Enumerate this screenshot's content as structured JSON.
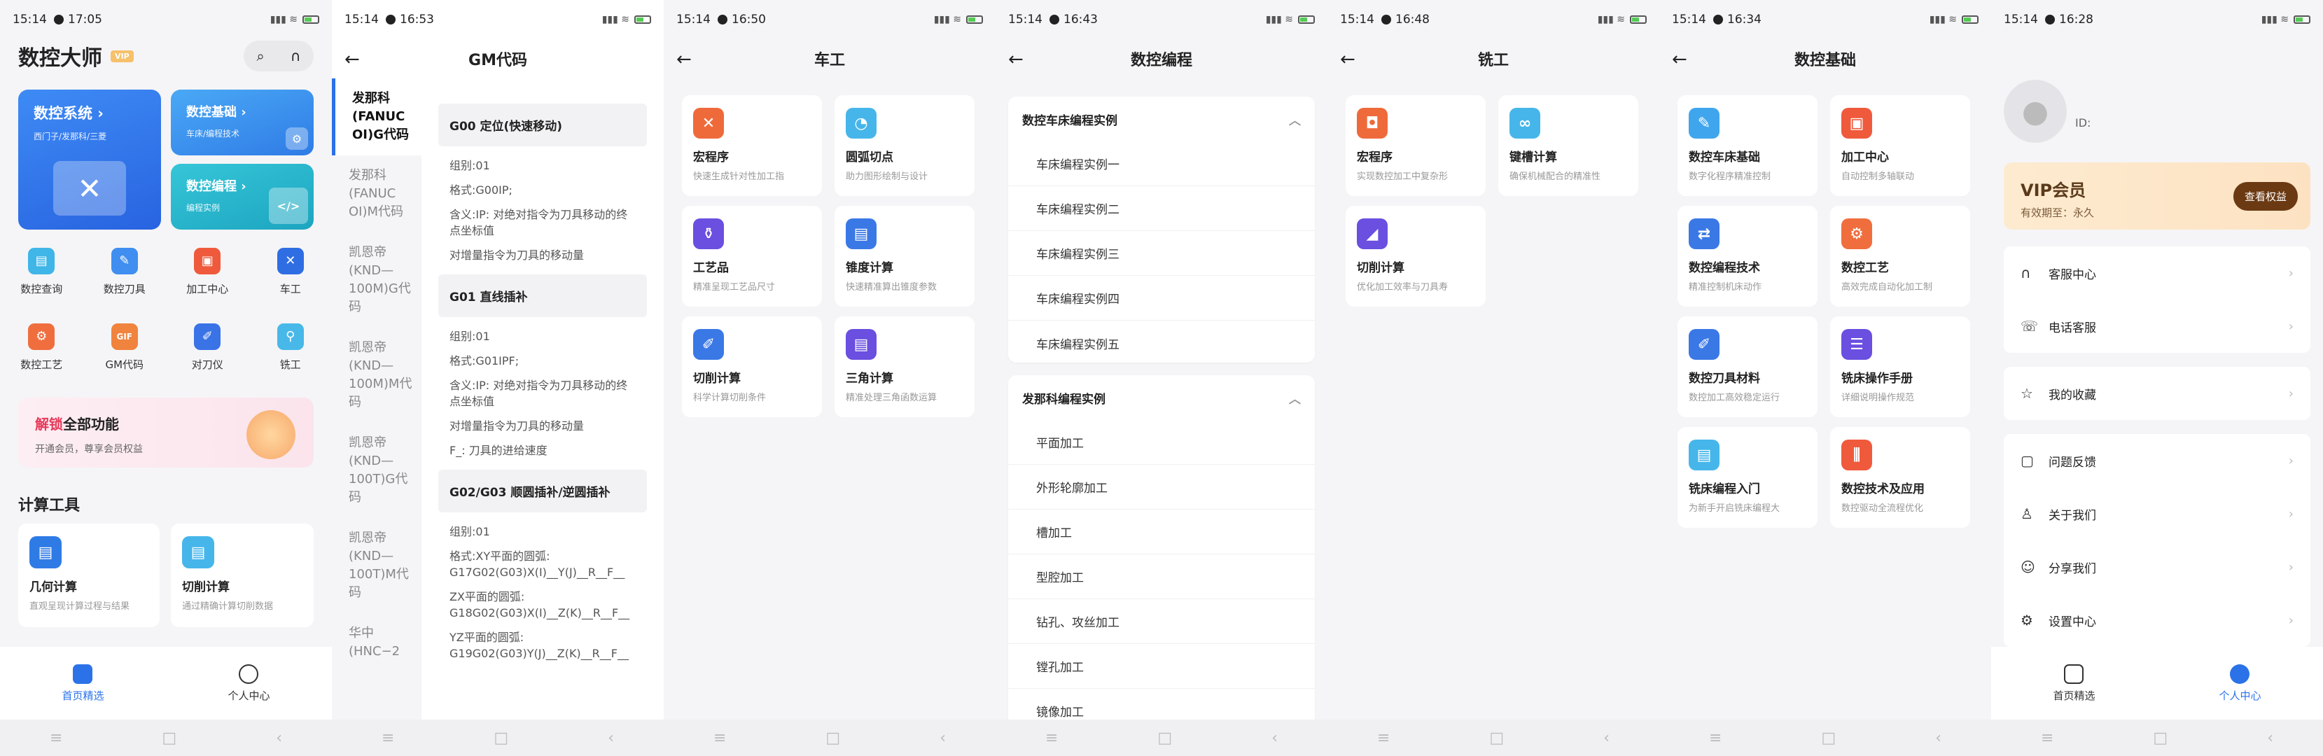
{
  "home": {
    "status": {
      "time": "15:14",
      "alarm": "17:05"
    },
    "app_title": "数控大师",
    "vip_badge": "VIP",
    "banners": [
      {
        "title": "数控系统 ›",
        "sub": "西门子/发那科/三菱"
      },
      {
        "title": "数控基础 ›",
        "sub": "车床/编程技术"
      },
      {
        "title": "数控编程 ›",
        "sub": "编程实例"
      }
    ],
    "grid": [
      {
        "label": "数控查询",
        "icon": "doc-icon",
        "color": "#3fb5e8"
      },
      {
        "label": "数控刀具",
        "icon": "tool-icon",
        "color": "#3f8ef0"
      },
      {
        "label": "加工中心",
        "icon": "machine-icon",
        "color": "#ef5a3c"
      },
      {
        "label": "车工",
        "icon": "lathe-icon",
        "color": "#2f6de3"
      },
      {
        "label": "数控工艺",
        "icon": "gear-icon",
        "color": "#f06e3e"
      },
      {
        "label": "GM代码",
        "icon": "gif-icon",
        "color": "#f0833e"
      },
      {
        "label": "对刀仪",
        "icon": "pen-icon",
        "color": "#3a73e6"
      },
      {
        "label": "铣工",
        "icon": "mill-icon",
        "color": "#48b8e9"
      }
    ],
    "unlock": {
      "title_red": "解锁",
      "title_rest": "全部功能",
      "sub": "开通会员，尊享会员权益"
    },
    "calc_heading": "计算工具",
    "calc": [
      {
        "title": "几何计算",
        "sub": "直观呈现计算过程与结果"
      },
      {
        "title": "切削计算",
        "sub": "通过精确计算切削数据"
      }
    ],
    "tabs": {
      "home": "首页精选",
      "me": "个人中心"
    }
  },
  "gm": {
    "status": {
      "time": "15:14",
      "alarm": "16:53"
    },
    "title": "GM代码",
    "side": [
      "发那科(FANUC OI)G代码",
      "发那科(FANUC OI)M代码",
      "凯恩帝(KND—100M)G代码",
      "凯恩帝(KND—100M)M代码",
      "凯恩帝(KND—100T)G代码",
      "凯恩帝(KND—100T)M代码",
      "华中(HNC−2"
    ],
    "blocks": [
      {
        "head": "G00 定位(快速移动)",
        "lines": [
          "组别:01",
          "格式:G00IP;",
          "含义:IP: 对绝对指令为刀具移动的终点坐标值",
          "对增量指令为刀具的移动量"
        ]
      },
      {
        "head": "G01 直线插补",
        "lines": [
          "组别:01",
          "格式:G01IPF;",
          "含义:IP: 对绝对指令为刀具移动的终点坐标值",
          "对增量指令为刀具的移动量",
          "F_: 刀具的进给速度"
        ]
      },
      {
        "head": "G02/G03 顺圆插补/逆圆插补",
        "lines": [
          "组别:01",
          "格式:XY平面的圆弧: G17G02(G03)X(I)__Y(J)__R__F__",
          "ZX平面的圆弧: G18G02(G03)X(I)__Z(K)__R__F__",
          "YZ平面的圆弧: G19G02(G03)Y(J)__Z(K)__R__F__"
        ]
      }
    ]
  },
  "lathe": {
    "status": {
      "time": "15:14",
      "alarm": "16:50"
    },
    "title": "车工",
    "cards": [
      {
        "title": "宏程序",
        "sub": "快速生成针对性加工指",
        "color": "#ef6a3a"
      },
      {
        "title": "圆弧切点",
        "sub": "助力图形绘制与设计",
        "color": "#46b6ea"
      },
      {
        "title": "工艺品",
        "sub": "精准呈现工艺品尺寸",
        "color": "#6a4fe0"
      },
      {
        "title": "锥度计算",
        "sub": "快速精准算出锥度参数",
        "color": "#3a78e6"
      },
      {
        "title": "切削计算",
        "sub": "科学计算切削条件",
        "color": "#3a78e6"
      },
      {
        "title": "三角计算",
        "sub": "精准处理三角函数运算",
        "color": "#6a4fe0"
      }
    ]
  },
  "prog": {
    "status": {
      "time": "15:14",
      "alarm": "16:43"
    },
    "title": "数控编程",
    "sections": [
      {
        "head": "数控车床编程实例",
        "items": [
          "车床编程实例一",
          "车床编程实例二",
          "车床编程实例三",
          "车床编程实例四",
          "车床编程实例五"
        ]
      },
      {
        "head": "发那科编程实例",
        "items": [
          "平面加工",
          "外形轮廓加工",
          "槽加工",
          "型腔加工",
          "钻孔、攻丝加工",
          "镗孔加工",
          "镜像加工"
        ]
      }
    ]
  },
  "mill": {
    "status": {
      "time": "15:14",
      "alarm": "16:48"
    },
    "title": "铣工",
    "cards": [
      {
        "title": "宏程序",
        "sub": "实现数控加工中复杂形",
        "color": "#ef6a3a"
      },
      {
        "title": "键槽计算",
        "sub": "确保机械配合的精准性",
        "color": "#46b6ea"
      },
      {
        "title": "切削计算",
        "sub": "优化加工效率与刀具寿",
        "color": "#6a4fe0"
      }
    ]
  },
  "basics": {
    "status": {
      "time": "15:14",
      "alarm": "16:34"
    },
    "title": "数控基础",
    "cards": [
      {
        "title": "数控车床基础",
        "sub": "数字化程序精准控制",
        "color": "#3fa6ee"
      },
      {
        "title": "加工中心",
        "sub": "自动控制多轴联动",
        "color": "#ef5a3c"
      },
      {
        "title": "数控编程技术",
        "sub": "精准控制机床动作",
        "color": "#3a78e6"
      },
      {
        "title": "数控工艺",
        "sub": "高效完成自动化加工制",
        "color": "#f06e3e"
      },
      {
        "title": "数控刀具材料",
        "sub": "数控加工高效稳定运行",
        "color": "#3a78e6"
      },
      {
        "title": "铣床操作手册",
        "sub": "详细说明操作规范",
        "color": "#6a4fe0"
      },
      {
        "title": "铣床编程入门",
        "sub": "为新手开启铣床编程大",
        "color": "#46b6ea"
      },
      {
        "title": "数控技术及应用",
        "sub": "数控驱动全流程优化",
        "color": "#ef5a3c"
      }
    ]
  },
  "profile": {
    "status": {
      "time": "15:14",
      "alarm": "16:28"
    },
    "id_label": "ID:",
    "vip": {
      "title": "VIP会员",
      "sub": "有效期至：永久",
      "button": "查看权益"
    },
    "group1": [
      {
        "label": "客服中心",
        "icon": "headset-icon"
      },
      {
        "label": "电话客服",
        "icon": "phone-icon"
      }
    ],
    "group2": [
      {
        "label": "我的收藏",
        "icon": "star-icon"
      }
    ],
    "group3": [
      {
        "label": "问题反馈",
        "icon": "feedback-icon"
      },
      {
        "label": "关于我们",
        "icon": "user-icon"
      },
      {
        "label": "分享我们",
        "icon": "smile-icon"
      },
      {
        "label": "设置中心",
        "icon": "settings-icon"
      }
    ],
    "tabs": {
      "home": "首页精选",
      "me": "个人中心"
    }
  }
}
